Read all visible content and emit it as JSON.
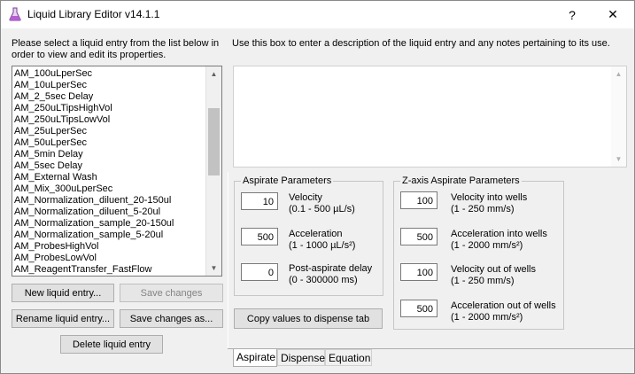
{
  "window": {
    "title": "Liquid Library Editor v14.1.1",
    "help_label": "?",
    "close_label": "✕"
  },
  "list_instructions": [
    "Please select a liquid entry from the list below in",
    "order to view and edit its properties."
  ],
  "description_instructions": "Use this box to enter a description of the liquid entry and any notes pertaining to its use.",
  "liquid_entries": [
    "AM_100uLperSec",
    "AM_10uLperSec",
    "AM_2_5sec Delay",
    "AM_250uLTipsHighVol",
    "AM_250uLTipsLowVol",
    "AM_25uLperSec",
    "AM_50uLperSec",
    "AM_5min Delay",
    "AM_5sec Delay",
    "AM_External Wash",
    "AM_Mix_300uLperSec",
    "AM_Normalization_diluent_20-150ul",
    "AM_Normalization_diluent_5-20ul",
    "AM_Normalization_sample_20-150ul",
    "AM_Normalization_sample_5-20ul",
    "AM_ProbesHighVol",
    "AM_ProbesLowVol",
    "AM_ReagentTransfer_FastFlow"
  ],
  "buttons": {
    "new_entry": "New liquid entry...",
    "save_changes": "Save changes",
    "rename_entry": "Rename liquid entry...",
    "save_as": "Save changes as...",
    "delete_entry": "Delete liquid entry",
    "copy_values": "Copy values to dispense tab"
  },
  "aspirate": {
    "title": "Aspirate Parameters",
    "params": [
      {
        "value": "10",
        "label": "Velocity",
        "range": "(0.1 - 500 µL/s)"
      },
      {
        "value": "500",
        "label": "Acceleration",
        "range": "(1 - 1000 µL/s²)"
      },
      {
        "value": "0",
        "label": "Post-aspirate delay",
        "range": "(0 - 300000 ms)"
      }
    ]
  },
  "zaxis": {
    "title": "Z-axis Aspirate Parameters",
    "params": [
      {
        "value": "100",
        "label": "Velocity into wells",
        "range": "(1 - 250 mm/s)"
      },
      {
        "value": "500",
        "label": "Acceleration into wells",
        "range": "(1 - 2000 mm/s²)"
      },
      {
        "value": "100",
        "label": "Velocity out of wells",
        "range": "(1 - 250 mm/s)"
      },
      {
        "value": "500",
        "label": "Acceleration out of wells",
        "range": "(1 - 2000 mm/s²)"
      }
    ]
  },
  "tabs": [
    "Aspirate",
    "Dispense",
    "Equation"
  ],
  "icons": {
    "app": "flask-icon",
    "scroll_up": "arrow-up-icon",
    "scroll_down": "arrow-down-icon"
  },
  "colors": {
    "flask": "#b35fd0",
    "window_bg": "#f0f0f0"
  }
}
